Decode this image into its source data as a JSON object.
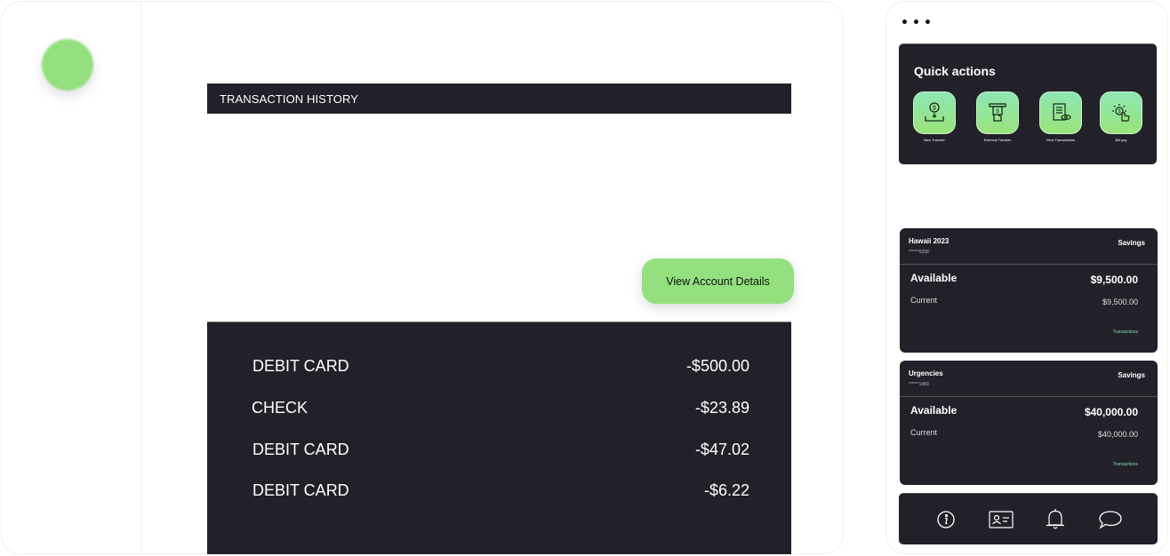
{
  "main": {
    "transaction_header": "TRANSACTION HISTORY",
    "view_account_button": "View Account Details",
    "transactions": [
      {
        "description": "DEBIT CARD",
        "amount": "-$500.00"
      },
      {
        "description": "CHECK",
        "amount": "-$23.89"
      },
      {
        "description": "DEBIT CARD",
        "amount": "-$47.02"
      },
      {
        "description": "DEBIT CARD",
        "amount": "-$6.22"
      }
    ]
  },
  "side": {
    "menu_icon": "more-horizontal-icon",
    "quick_actions": {
      "title": "Quick actions",
      "items": [
        {
          "label": "New Transfer",
          "icon": "deposit-dollar-icon"
        },
        {
          "label": "External Transfer",
          "icon": "atm-withdraw-icon"
        },
        {
          "label": "View Transactions",
          "icon": "document-eye-icon"
        },
        {
          "label": "Bill pay",
          "icon": "tap-dollar-icon"
        }
      ]
    },
    "accounts": [
      {
        "name": "Hawaii 2023",
        "mask": "******0258",
        "type": "Savings",
        "available_label": "Available",
        "available": "$9,500.00",
        "current_label": "Current",
        "current": "$9,500.00",
        "link": "Transactions"
      },
      {
        "name": "Urgencies",
        "mask": "******1483",
        "type": "Savings",
        "available_label": "Available",
        "available": "$40,000.00",
        "current_label": "Current",
        "current": "$40,000.00",
        "link": "Transactions"
      }
    ],
    "bottom_nav": [
      {
        "icon": "info-icon"
      },
      {
        "icon": "id-card-icon"
      },
      {
        "icon": "bell-icon"
      },
      {
        "icon": "chat-icon"
      }
    ]
  },
  "colors": {
    "accent_green": "#94e07f",
    "dark_panel": "#22212a",
    "link_green": "#7ee0b0"
  }
}
